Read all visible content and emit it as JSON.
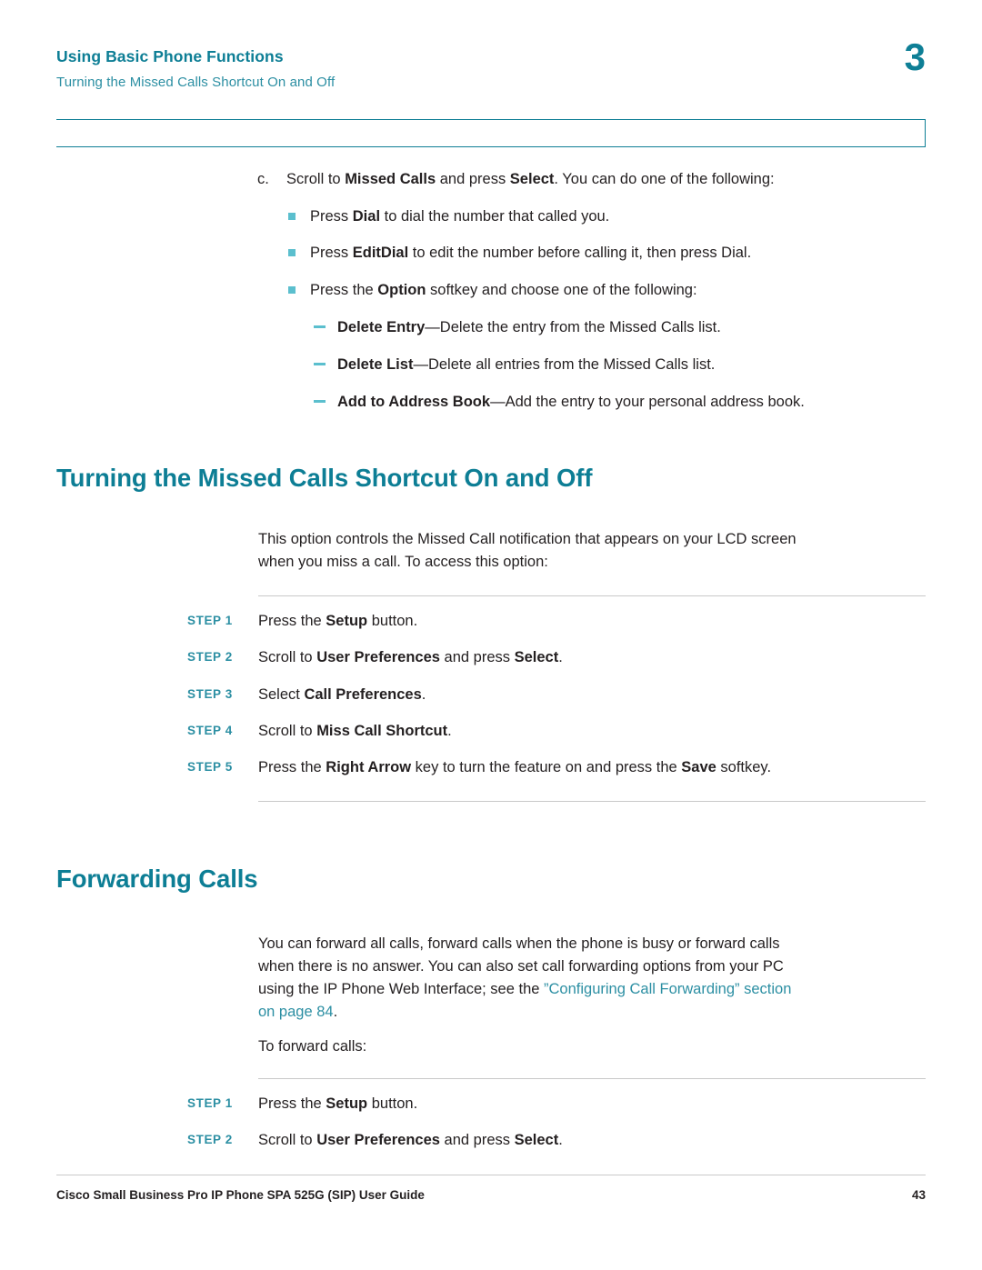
{
  "header": {
    "title": "Using Basic Phone Functions",
    "subtitle": "Turning the Missed Calls Shortcut On and Off",
    "chapter": "3"
  },
  "list": {
    "item_c_marker": "c.",
    "item_c_pre": "Scroll to ",
    "item_c_b1": "Missed Calls",
    "item_c_mid": " and press ",
    "item_c_b2": "Select",
    "item_c_post": ". You can do one of the following:",
    "bullets": [
      {
        "pre": "Press ",
        "b": "Dial",
        "post": " to dial the number that called you."
      },
      {
        "pre": "Press ",
        "b": "EditDial",
        "post": " to edit the number before calling it, then press Dial."
      },
      {
        "pre": "Press the ",
        "b": "Option",
        "post": " softkey and choose one of the following:"
      }
    ],
    "dashes": [
      {
        "b": "Delete Entry",
        "post": "—Delete the entry from the Missed Calls list."
      },
      {
        "b": "Delete List",
        "post": "—Delete all entries from the Missed Calls list."
      },
      {
        "b": "Add to Address Book",
        "post": "—Add the entry to your personal address book."
      }
    ]
  },
  "section1": {
    "title": "Turning the Missed Calls Shortcut On and Off",
    "intro_line1": "This option controls the Missed Call notification that appears on your LCD screen",
    "intro_line2": "when you miss a call. To access this option:",
    "steps": [
      {
        "label": "STEP 1",
        "pre": "Press the ",
        "b": "Setup",
        "post": " button."
      },
      {
        "label": "STEP 2",
        "pre": "Scroll to ",
        "b": "User Preferences",
        "mid": " and press ",
        "b2": "Select",
        "post": "."
      },
      {
        "label": "STEP 3",
        "pre": "Select ",
        "b": "Call Preferences",
        "post": "."
      },
      {
        "label": "STEP 4",
        "pre": "Scroll to ",
        "b": "Miss Call Shortcut",
        "post": "."
      },
      {
        "label": "STEP 5",
        "pre": "Press the ",
        "b": "Right Arrow",
        "mid": " key to turn the feature on and press the ",
        "b2": "Save",
        "post": " softkey."
      }
    ]
  },
  "section2": {
    "title": "Forwarding Calls",
    "intro_line1": "You can forward all calls, forward calls when the phone is busy or forward calls",
    "intro_line2": "when there is no answer. You can also set call forwarding options from your PC",
    "intro_line3_pre": "using the IP Phone Web Interface; see the ",
    "intro_link1": "”Configuring Call Forwarding” section",
    "intro_link2": "on page 84",
    "intro_line4_post": ".",
    "to_forward": "To forward calls:",
    "steps": [
      {
        "label": "STEP 1",
        "pre": "Press the ",
        "b": "Setup",
        "post": " button."
      },
      {
        "label": "STEP 2",
        "pre": "Scroll to ",
        "b": "User Preferences",
        "mid": " and press ",
        "b2": "Select",
        "post": "."
      }
    ]
  },
  "footer": {
    "text": "Cisco Small Business Pro IP Phone SPA 525G (SIP) User Guide",
    "page": "43"
  }
}
